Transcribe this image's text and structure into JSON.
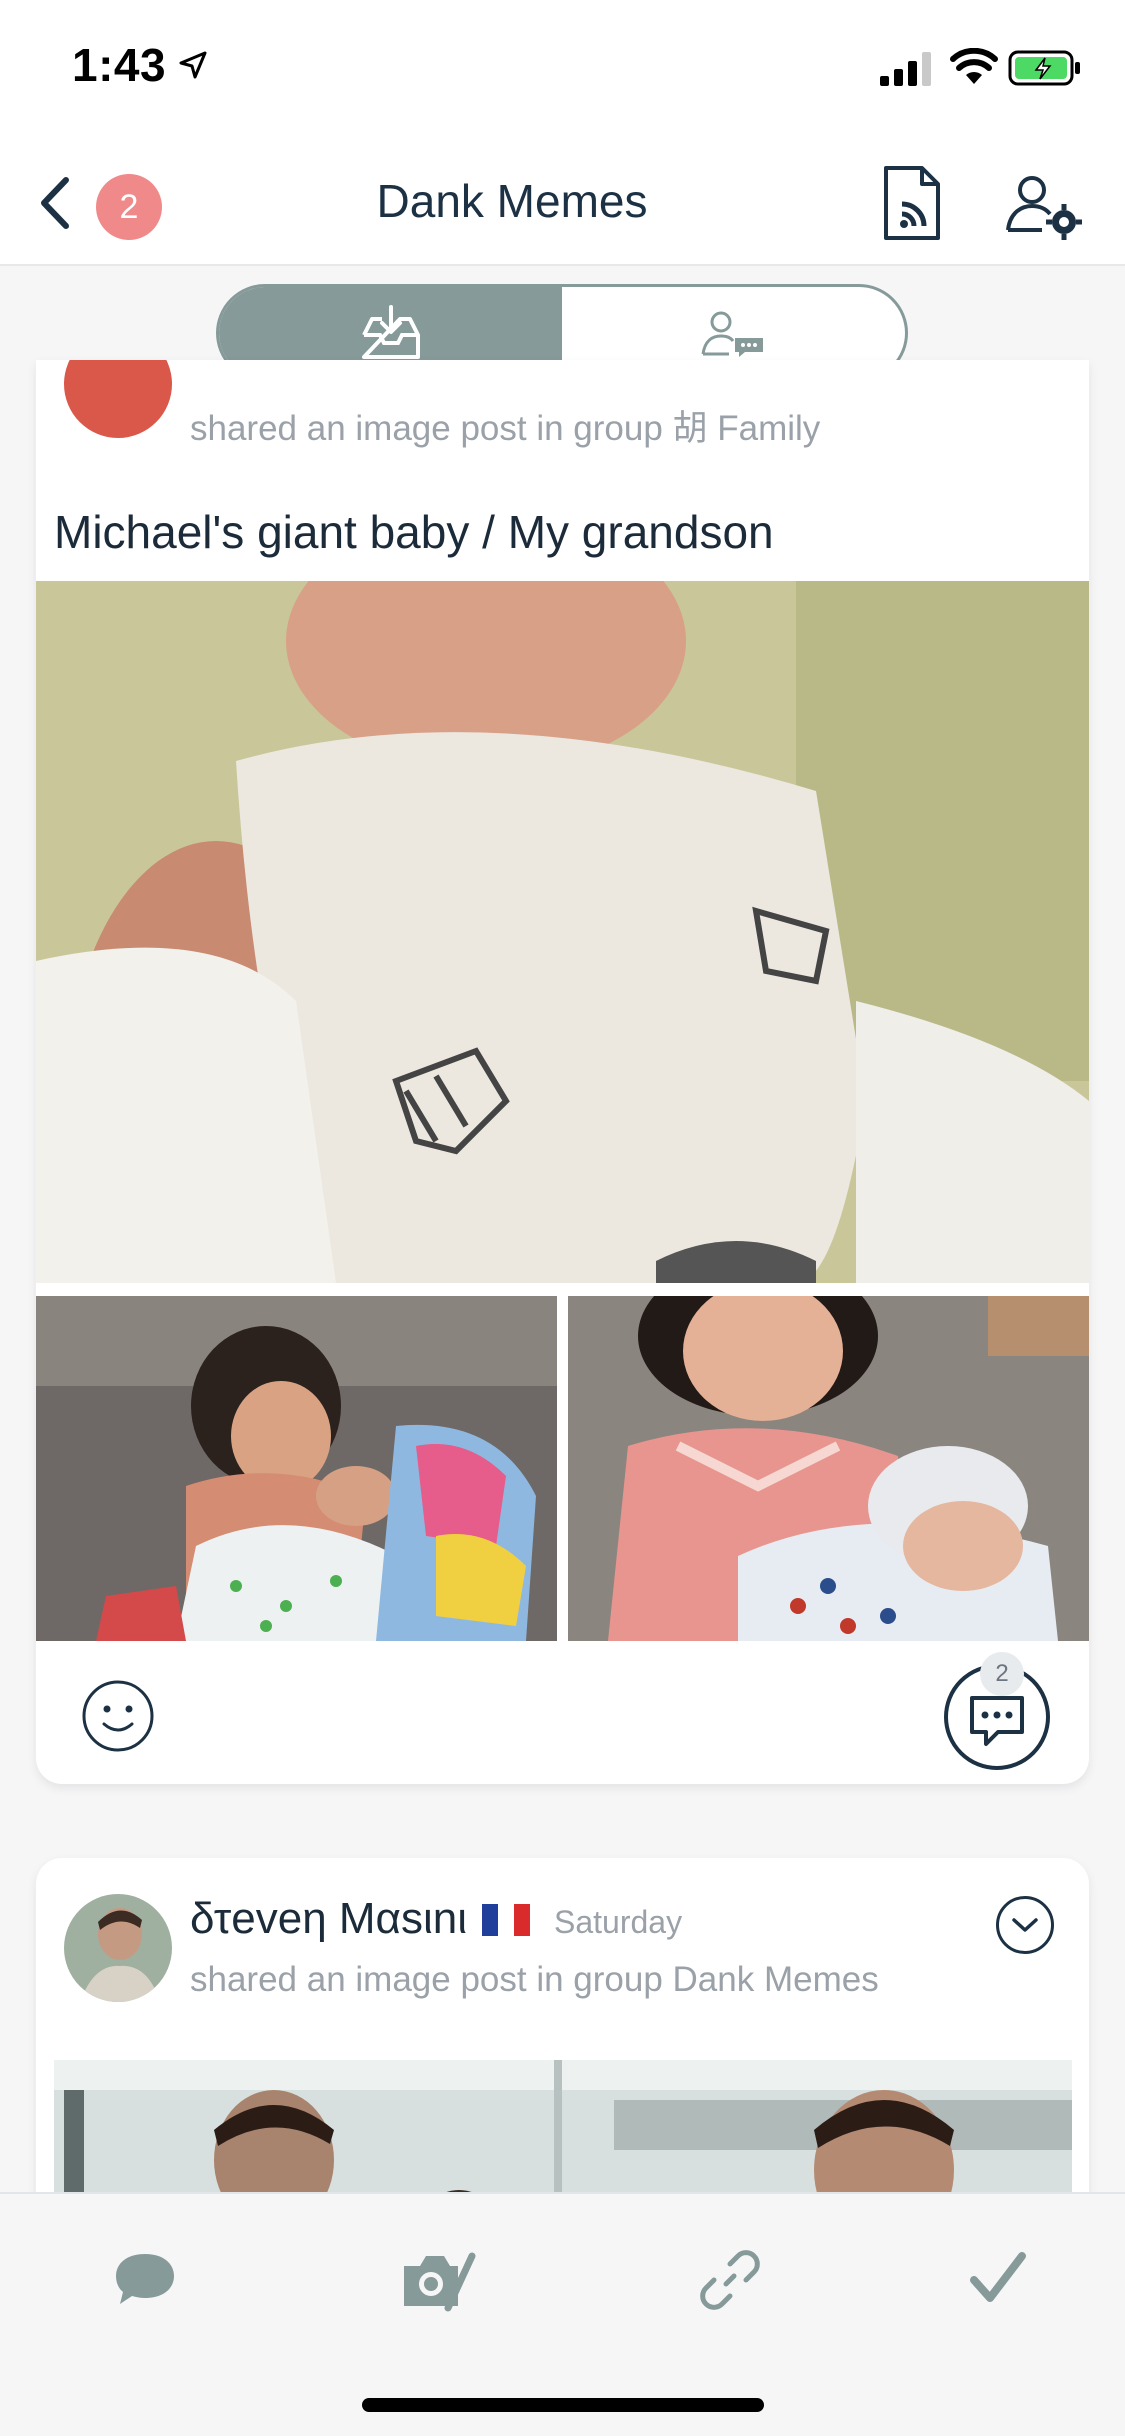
{
  "status_bar": {
    "time": "1:43"
  },
  "nav": {
    "title": "Dank Memes",
    "badge_count": "2"
  },
  "segments": [
    {
      "name": "inbox",
      "icon": "inbox-download-icon",
      "active": true
    },
    {
      "name": "group-chat",
      "icon": "people-chat-icon",
      "active": false
    }
  ],
  "posts": [
    {
      "subtitle": "shared an image post in group 胡 Family",
      "title": "Michael's giant baby / My grandson",
      "images": [
        "sleeping-newborn-photo",
        "girl-feeding-baby-photo",
        "girl-holding-baby-photo"
      ],
      "comment_count": "2"
    },
    {
      "author": "δτeveη Mαsιnι",
      "date": "Saturday",
      "subtitle": "shared an image post in group Dank Memes",
      "images": [
        "mr-bean-meme-photo"
      ]
    }
  ],
  "bottom_tabs": [
    {
      "name": "text-post",
      "icon": "speech-bubble-icon"
    },
    {
      "name": "photo-post",
      "icon": "camera-icon"
    },
    {
      "name": "link-post",
      "icon": "link-icon"
    },
    {
      "name": "task-post",
      "icon": "checkmark-icon"
    }
  ],
  "colors": {
    "accent": "#869a9a",
    "badge": "#f08a8a",
    "text_dark": "#1c3144",
    "text_muted": "#9aa1a8"
  }
}
